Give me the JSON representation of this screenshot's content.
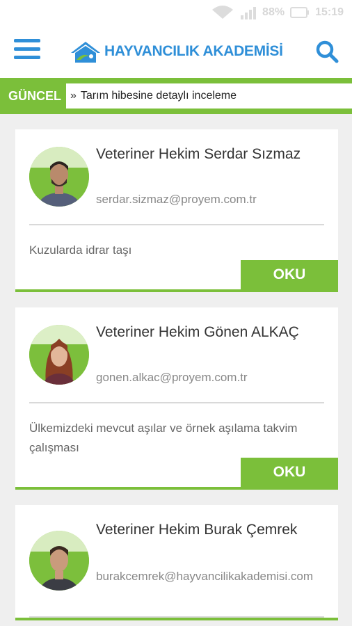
{
  "status_bar": {
    "battery": "88%",
    "time": "15:19"
  },
  "header": {
    "logo_text": "HAYVANCILIK AKADEMİSİ",
    "brand_color": "#2f8fd8",
    "accent_color": "#7bbf3a",
    "menu_icon": "hamburger-menu-icon",
    "search_icon": "search-icon"
  },
  "ticker": {
    "label": "GÜNCEL",
    "headline": "Tarım hibesine detaylı inceleme"
  },
  "articles": [
    {
      "author": "Veteriner Hekim Serdar Sızmaz",
      "email": "serdar.sizmaz@proyem.com.tr",
      "summary": "Kuzularda idrar taşı",
      "read_label": "OKU"
    },
    {
      "author": "Veteriner Hekim Gönen ALKAÇ",
      "email": "gonen.alkac@proyem.com.tr",
      "summary": "Ülkemizdeki mevcut aşılar ve örnek aşılama takvim çalışması",
      "read_label": "OKU"
    },
    {
      "author": "Veteriner Hekim Burak Çemrek",
      "email": "burakcemrek@hayvancilikakademisi.com",
      "summary": "",
      "read_label": ""
    }
  ]
}
